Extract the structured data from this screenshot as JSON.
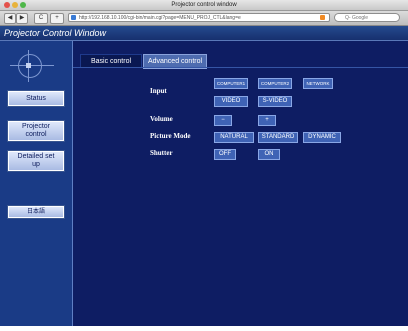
{
  "browser": {
    "window_title": "Projector control window",
    "url": "http://192.168.10.100/cgi-bin/main.cgi?page=MENU_PROJ_CTL&lang=e",
    "search_placeholder": "Q- Google",
    "back_label": "◀",
    "forward_label": "▶",
    "reload_label": "C",
    "add_label": "+"
  },
  "app": {
    "title": "Projector Control Window"
  },
  "sidebar": {
    "items": [
      {
        "label": "Status"
      },
      {
        "label": "Projector control"
      },
      {
        "label": "Detailed set up"
      },
      {
        "label": "日本語"
      }
    ]
  },
  "tabs": [
    {
      "label": "Basic control"
    },
    {
      "label": "Advanced control"
    }
  ],
  "controls": {
    "input_label": "Input",
    "input_buttons": [
      "COMPUTER1",
      "COMPUTER2",
      "NETWORK",
      "VIDEO",
      "S-VIDEO"
    ],
    "volume_label": "Volume",
    "volume_buttons": [
      "−",
      "+"
    ],
    "picture_mode_label": "Picture Mode",
    "picture_mode_buttons": [
      "NATURAL",
      "STANDARD",
      "DYNAMIC"
    ],
    "shutter_label": "Shutter",
    "shutter_buttons": [
      "OFF",
      "ON"
    ]
  },
  "colors": {
    "page_bg": "#0e1d63",
    "sidebar_bg": "#1a3b86",
    "button_bg": "#3f63b5"
  }
}
